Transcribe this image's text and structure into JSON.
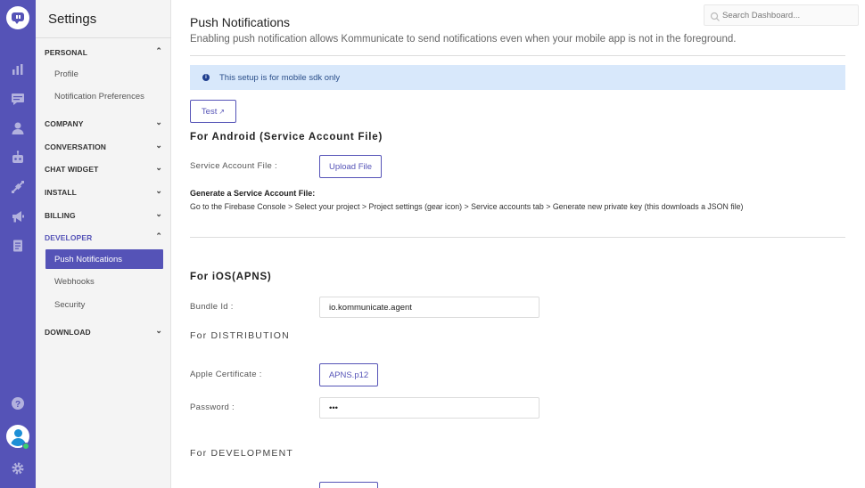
{
  "rail": {
    "icons": [
      "kommunicate-logo-icon",
      "reports-icon",
      "conversations-icon",
      "users-icon",
      "bot-icon",
      "integrations-icon",
      "campaigns-icon",
      "knowledge-base-icon",
      "help-icon",
      "avatar",
      "settings-gear-icon"
    ]
  },
  "sidebar": {
    "title": "Settings",
    "sections": {
      "personal": {
        "label": "PERSONAL",
        "items": [
          "Profile",
          "Notification Preferences"
        ]
      },
      "company": {
        "label": "COMPANY"
      },
      "conversation": {
        "label": "CONVERSATION"
      },
      "chat_widget": {
        "label": "CHAT WIDGET"
      },
      "install": {
        "label": "INSTALL"
      },
      "billing": {
        "label": "BILLING"
      },
      "developer": {
        "label": "DEVELOPER",
        "items": [
          "Push Notifications",
          "Webhooks",
          "Security"
        ]
      },
      "download": {
        "label": "DOWNLOAD"
      }
    },
    "active_item": "Push Notifications"
  },
  "search": {
    "placeholder": "Search Dashboard..."
  },
  "main": {
    "title": "Push Notifications",
    "description": "Enabling push notification allows Kommunicate to send notifications even when your mobile app is not in the foreground.",
    "info_text": "This setup is for mobile sdk only",
    "test_button": "Test",
    "android": {
      "heading": "For Android (Service Account File)",
      "service_account_label": "Service Account File :",
      "upload_button": "Upload File",
      "generate_title": "Generate a Service Account File:",
      "generate_steps": "Go to the Firebase Console > Select your project > Project settings (gear icon) > Service accounts tab > Generate new private key (this downloads a JSON file)"
    },
    "ios": {
      "heading": "For iOS(APNS)",
      "bundle_label": "Bundle Id :",
      "bundle_value": "io.kommunicate.agent",
      "distribution": {
        "heading": "For DISTRIBUTION",
        "cert_label": "Apple Certificate :",
        "cert_button": "APNS.p12",
        "password_label": "Password :",
        "password_value": "•••"
      },
      "development": {
        "heading": "For DEVELOPMENT"
      }
    }
  },
  "colors": {
    "brand": "#5553b7",
    "info_bg": "#d8e8fb",
    "online": "#3bd16f"
  }
}
